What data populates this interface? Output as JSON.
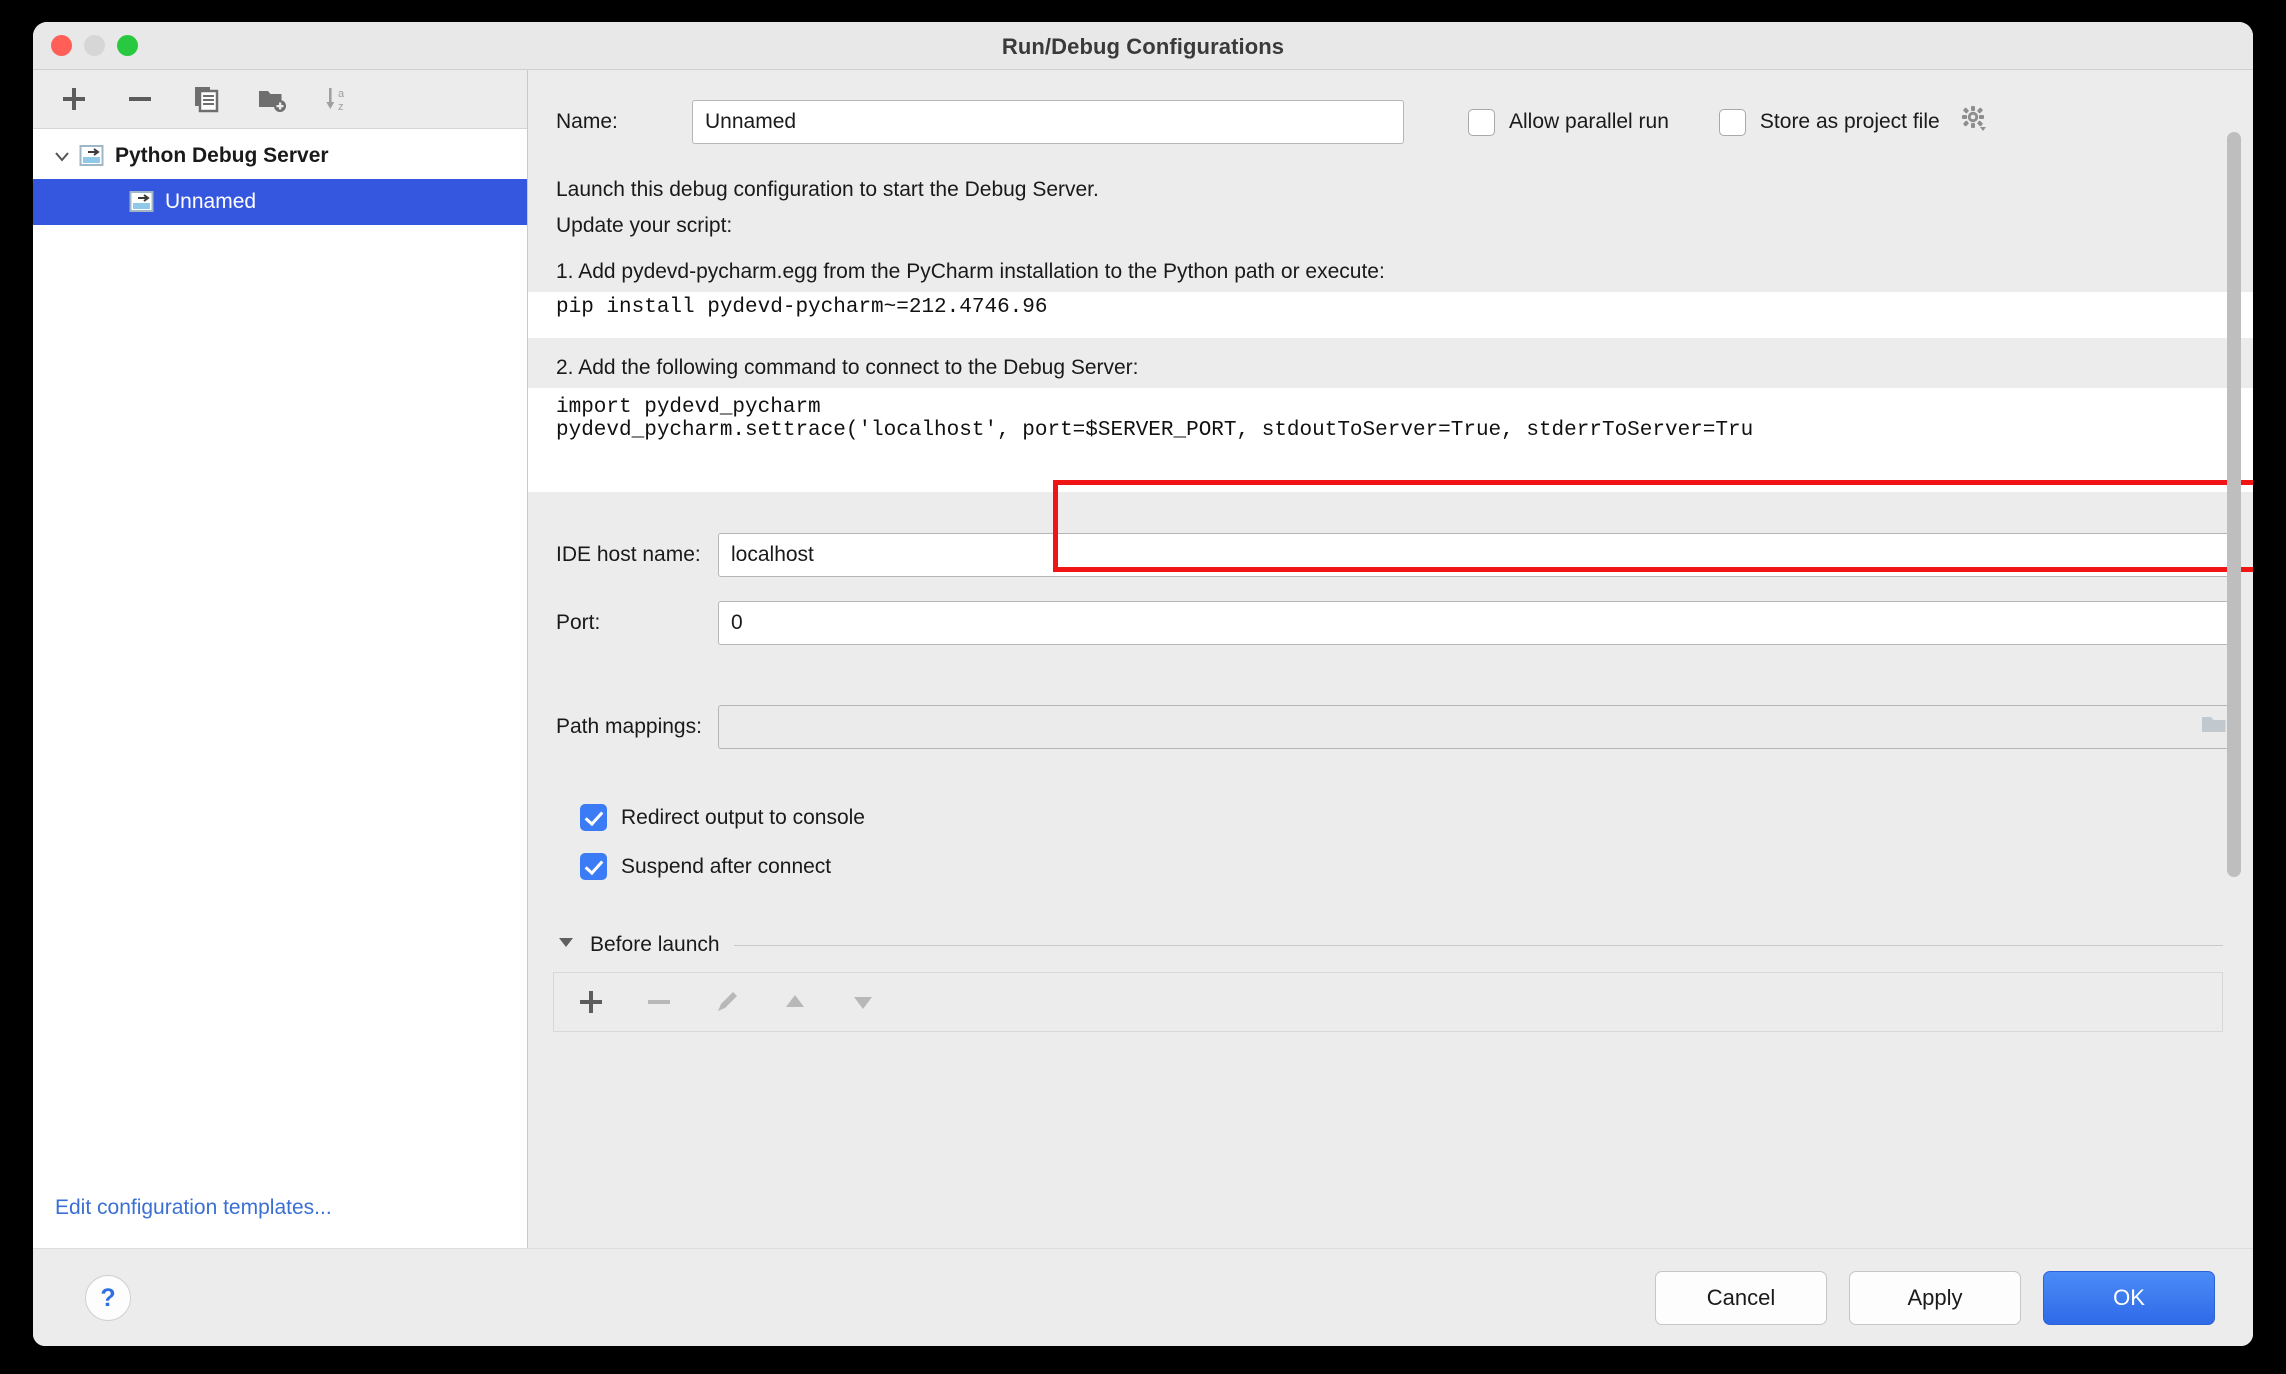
{
  "window": {
    "title": "Run/Debug Configurations",
    "traffic_lights": [
      "close-red",
      "minimize-yellow",
      "zoom-green"
    ]
  },
  "sidebar": {
    "toolbar": [
      {
        "name": "add-configuration-button",
        "icon": "plus-icon",
        "label": "+"
      },
      {
        "name": "remove-configuration-button",
        "icon": "minus-icon",
        "label": "−"
      },
      {
        "name": "copy-configuration-button",
        "icon": "copy-icon",
        "label": ""
      },
      {
        "name": "new-folder-button",
        "icon": "folder-add-icon",
        "label": ""
      },
      {
        "name": "sort-configurations-button",
        "icon": "sort-az-icon",
        "label": ""
      }
    ],
    "tree": [
      {
        "label": "Python Debug Server",
        "type": "group",
        "expanded": true,
        "icon": "python-debug-server-icon",
        "selected": false
      },
      {
        "label": "Unnamed",
        "type": "child",
        "icon": "python-debug-server-icon",
        "selected": true
      }
    ],
    "edit_templates_link": "Edit configuration templates..."
  },
  "form": {
    "name_label": "Name:",
    "name_value": "Unnamed",
    "name_placeholder": "Unnamed",
    "allow_parallel_run": {
      "label": "Allow parallel run",
      "checked": false
    },
    "store_as_project_file": {
      "label": "Store as project file",
      "checked": false
    },
    "gear_icon": "gear-icon"
  },
  "description": {
    "line1": "Launch this debug configuration to start the Debug Server.",
    "line2": "Update your script:",
    "step1": "1. Add pydevd-pycharm.egg from the PyCharm installation to the Python path or execute:",
    "step1_code": "pip install pydevd-pycharm~=212.4746.96",
    "step2": "2. Add the following command to connect to the Debug Server:",
    "step2_code_line1": "import pydevd_pycharm",
    "step2_code_line2": "pydevd_pycharm.settrace('localhost', port=$SERVER_PORT, stdoutToServer=True, stderrToServer=Tru",
    "highlight_color": "#f01414"
  },
  "fields": {
    "ide_host_name": {
      "label": "IDE host name:",
      "value": "localhost"
    },
    "port": {
      "label": "Port:",
      "value": "0"
    },
    "path_mappings": {
      "label": "Path mappings:",
      "value": "",
      "browse_icon": "folder-browse-icon",
      "disabled": true
    }
  },
  "options": {
    "redirect_output": {
      "label": "Redirect output to console",
      "checked": true
    },
    "suspend_after_connect": {
      "label": "Suspend after connect",
      "checked": true
    }
  },
  "before_launch": {
    "title": "Before launch",
    "expanded": true,
    "toolbar": [
      {
        "name": "bl-add-button",
        "icon": "plus-icon",
        "label": "+",
        "enabled": true
      },
      {
        "name": "bl-remove-button",
        "icon": "minus-icon",
        "label": "−",
        "enabled": false
      },
      {
        "name": "bl-edit-button",
        "icon": "pencil-icon",
        "label": "",
        "enabled": false
      },
      {
        "name": "bl-move-up-button",
        "icon": "arrow-up-icon",
        "label": "",
        "enabled": false
      },
      {
        "name": "bl-move-down-button",
        "icon": "arrow-down-icon",
        "label": "",
        "enabled": false
      }
    ]
  },
  "footer": {
    "help_label": "?",
    "cancel_label": "Cancel",
    "apply_label": "Apply",
    "ok_label": "OK"
  }
}
